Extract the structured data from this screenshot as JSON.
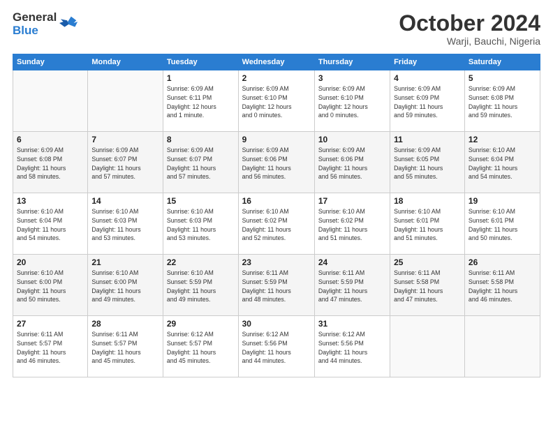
{
  "header": {
    "logo_text_general": "General",
    "logo_text_blue": "Blue",
    "month": "October 2024",
    "location": "Warji, Bauchi, Nigeria"
  },
  "weekdays": [
    "Sunday",
    "Monday",
    "Tuesday",
    "Wednesday",
    "Thursday",
    "Friday",
    "Saturday"
  ],
  "weeks": [
    [
      {
        "day": "",
        "info": ""
      },
      {
        "day": "",
        "info": ""
      },
      {
        "day": "1",
        "info": "Sunrise: 6:09 AM\nSunset: 6:11 PM\nDaylight: 12 hours\nand 1 minute."
      },
      {
        "day": "2",
        "info": "Sunrise: 6:09 AM\nSunset: 6:10 PM\nDaylight: 12 hours\nand 0 minutes."
      },
      {
        "day": "3",
        "info": "Sunrise: 6:09 AM\nSunset: 6:10 PM\nDaylight: 12 hours\nand 0 minutes."
      },
      {
        "day": "4",
        "info": "Sunrise: 6:09 AM\nSunset: 6:09 PM\nDaylight: 11 hours\nand 59 minutes."
      },
      {
        "day": "5",
        "info": "Sunrise: 6:09 AM\nSunset: 6:08 PM\nDaylight: 11 hours\nand 59 minutes."
      }
    ],
    [
      {
        "day": "6",
        "info": "Sunrise: 6:09 AM\nSunset: 6:08 PM\nDaylight: 11 hours\nand 58 minutes."
      },
      {
        "day": "7",
        "info": "Sunrise: 6:09 AM\nSunset: 6:07 PM\nDaylight: 11 hours\nand 57 minutes."
      },
      {
        "day": "8",
        "info": "Sunrise: 6:09 AM\nSunset: 6:07 PM\nDaylight: 11 hours\nand 57 minutes."
      },
      {
        "day": "9",
        "info": "Sunrise: 6:09 AM\nSunset: 6:06 PM\nDaylight: 11 hours\nand 56 minutes."
      },
      {
        "day": "10",
        "info": "Sunrise: 6:09 AM\nSunset: 6:06 PM\nDaylight: 11 hours\nand 56 minutes."
      },
      {
        "day": "11",
        "info": "Sunrise: 6:09 AM\nSunset: 6:05 PM\nDaylight: 11 hours\nand 55 minutes."
      },
      {
        "day": "12",
        "info": "Sunrise: 6:10 AM\nSunset: 6:04 PM\nDaylight: 11 hours\nand 54 minutes."
      }
    ],
    [
      {
        "day": "13",
        "info": "Sunrise: 6:10 AM\nSunset: 6:04 PM\nDaylight: 11 hours\nand 54 minutes."
      },
      {
        "day": "14",
        "info": "Sunrise: 6:10 AM\nSunset: 6:03 PM\nDaylight: 11 hours\nand 53 minutes."
      },
      {
        "day": "15",
        "info": "Sunrise: 6:10 AM\nSunset: 6:03 PM\nDaylight: 11 hours\nand 53 minutes."
      },
      {
        "day": "16",
        "info": "Sunrise: 6:10 AM\nSunset: 6:02 PM\nDaylight: 11 hours\nand 52 minutes."
      },
      {
        "day": "17",
        "info": "Sunrise: 6:10 AM\nSunset: 6:02 PM\nDaylight: 11 hours\nand 51 minutes."
      },
      {
        "day": "18",
        "info": "Sunrise: 6:10 AM\nSunset: 6:01 PM\nDaylight: 11 hours\nand 51 minutes."
      },
      {
        "day": "19",
        "info": "Sunrise: 6:10 AM\nSunset: 6:01 PM\nDaylight: 11 hours\nand 50 minutes."
      }
    ],
    [
      {
        "day": "20",
        "info": "Sunrise: 6:10 AM\nSunset: 6:00 PM\nDaylight: 11 hours\nand 50 minutes."
      },
      {
        "day": "21",
        "info": "Sunrise: 6:10 AM\nSunset: 6:00 PM\nDaylight: 11 hours\nand 49 minutes."
      },
      {
        "day": "22",
        "info": "Sunrise: 6:10 AM\nSunset: 5:59 PM\nDaylight: 11 hours\nand 49 minutes."
      },
      {
        "day": "23",
        "info": "Sunrise: 6:11 AM\nSunset: 5:59 PM\nDaylight: 11 hours\nand 48 minutes."
      },
      {
        "day": "24",
        "info": "Sunrise: 6:11 AM\nSunset: 5:59 PM\nDaylight: 11 hours\nand 47 minutes."
      },
      {
        "day": "25",
        "info": "Sunrise: 6:11 AM\nSunset: 5:58 PM\nDaylight: 11 hours\nand 47 minutes."
      },
      {
        "day": "26",
        "info": "Sunrise: 6:11 AM\nSunset: 5:58 PM\nDaylight: 11 hours\nand 46 minutes."
      }
    ],
    [
      {
        "day": "27",
        "info": "Sunrise: 6:11 AM\nSunset: 5:57 PM\nDaylight: 11 hours\nand 46 minutes."
      },
      {
        "day": "28",
        "info": "Sunrise: 6:11 AM\nSunset: 5:57 PM\nDaylight: 11 hours\nand 45 minutes."
      },
      {
        "day": "29",
        "info": "Sunrise: 6:12 AM\nSunset: 5:57 PM\nDaylight: 11 hours\nand 45 minutes."
      },
      {
        "day": "30",
        "info": "Sunrise: 6:12 AM\nSunset: 5:56 PM\nDaylight: 11 hours\nand 44 minutes."
      },
      {
        "day": "31",
        "info": "Sunrise: 6:12 AM\nSunset: 5:56 PM\nDaylight: 11 hours\nand 44 minutes."
      },
      {
        "day": "",
        "info": ""
      },
      {
        "day": "",
        "info": ""
      }
    ]
  ]
}
